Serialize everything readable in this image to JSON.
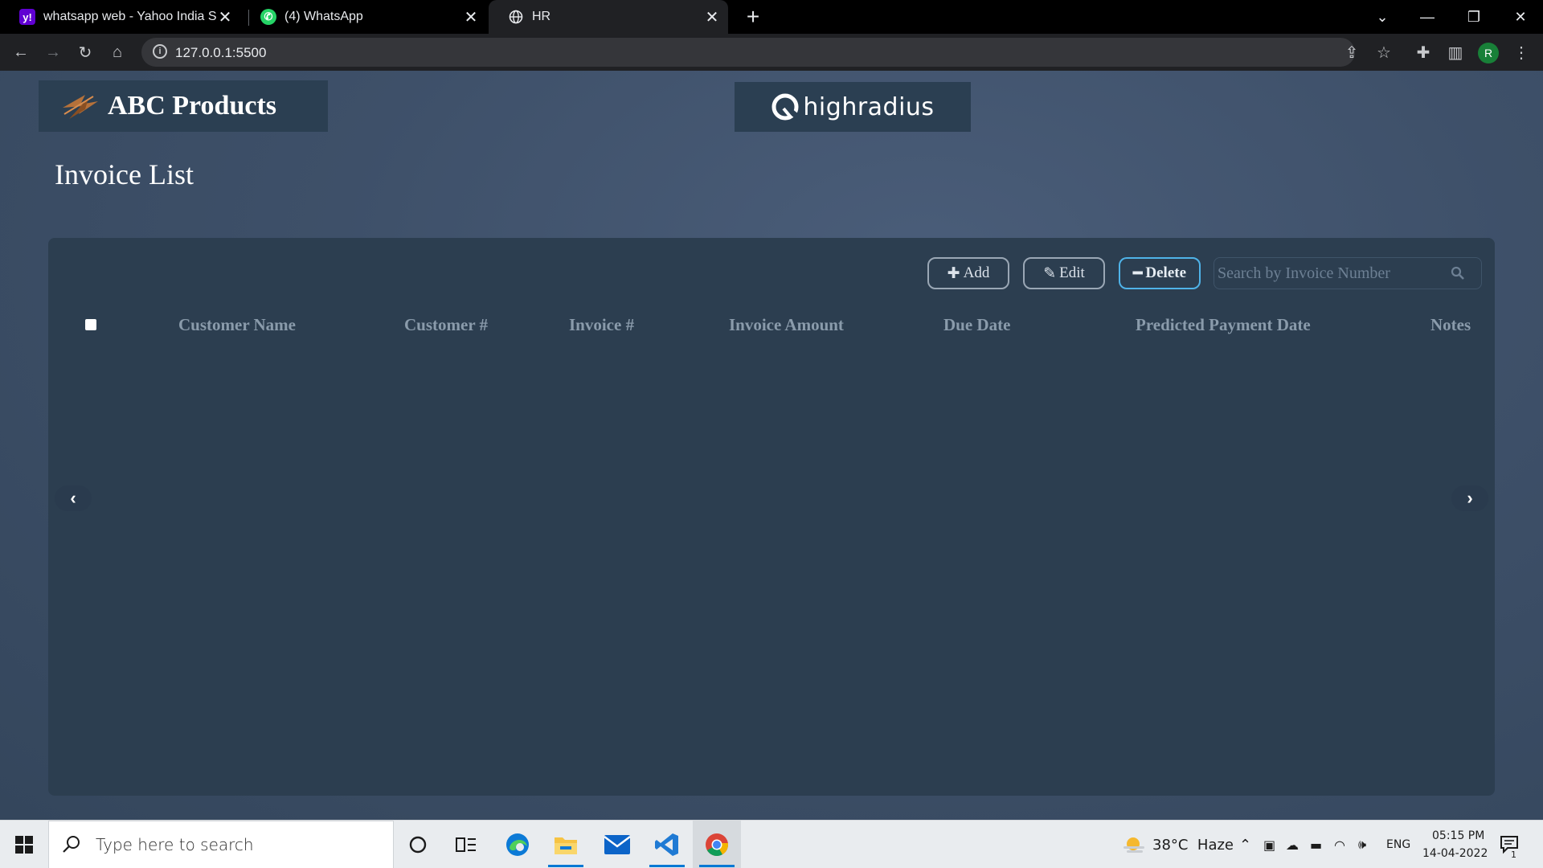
{
  "browser": {
    "tabs": [
      {
        "title": "whatsapp web - Yahoo India Sea",
        "favicon": "yahoo-icon",
        "active": false
      },
      {
        "title": "(4) WhatsApp",
        "favicon": "whatsapp-icon",
        "active": false
      },
      {
        "title": "HR",
        "favicon": "globe-icon",
        "active": true
      }
    ],
    "new_tab": "+",
    "url": "127.0.0.1:5500",
    "profile_initial": "R"
  },
  "header": {
    "brand_name": "ABC Products",
    "partner_name": "highradius"
  },
  "page_title": "Invoice List",
  "toolbar": {
    "add_label": "Add",
    "edit_label": "Edit",
    "delete_label": "Delete",
    "search_placeholder": "Search by Invoice Number"
  },
  "table": {
    "columns": [
      "Customer Name",
      "Customer #",
      "Invoice #",
      "Invoice Amount",
      "Due Date",
      "Predicted Payment Date",
      "Notes"
    ],
    "rows": []
  },
  "pager": {
    "prev": "‹",
    "next": "›"
  },
  "taskbar": {
    "search_placeholder": "Type here to search",
    "weather": "38°C  Haze",
    "language": "ENG",
    "time": "05:15 PM",
    "date": "14-04-2022",
    "notification_count": "1"
  },
  "colors": {
    "page_bg": "#3c4f68",
    "panel_bg": "#2c3e50",
    "header_text": "#8a9bab",
    "delete_border": "#4fb3e8"
  }
}
